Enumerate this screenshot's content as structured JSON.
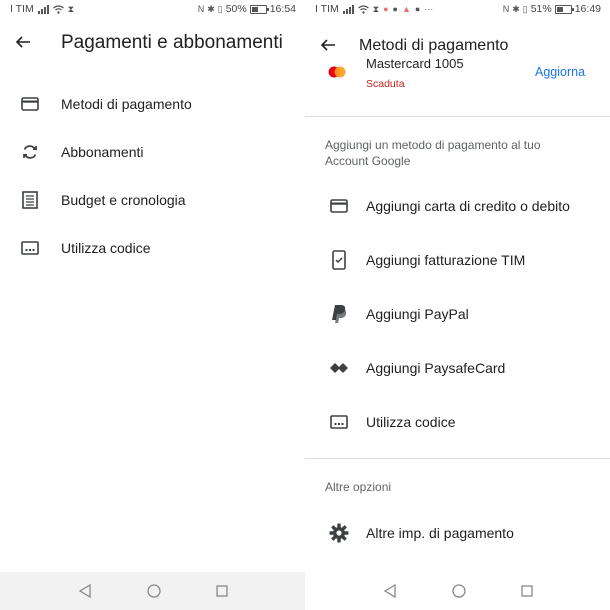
{
  "left": {
    "status": {
      "carrier": "I TIM",
      "battery": "50%",
      "time": "16:54"
    },
    "header": {
      "title": "Pagamenti e abbonamenti"
    },
    "menu": [
      {
        "label": "Metodi di pagamento",
        "icon": "credit-card-icon"
      },
      {
        "label": "Abbonamenti",
        "icon": "sync-icon"
      },
      {
        "label": "Budget e cronologia",
        "icon": "list-icon"
      },
      {
        "label": "Utilizza codice",
        "icon": "redeem-code-icon"
      }
    ]
  },
  "right": {
    "status": {
      "carrier": "I TIM",
      "battery": "51%",
      "time": "16:49"
    },
    "header": {
      "title": "Metodi di pagamento"
    },
    "card": {
      "name": "Mastercard 1005",
      "status": "Scaduta",
      "action": "Aggiorna"
    },
    "add_section": "Aggiungi un metodo di pagamento al tuo Account Google",
    "add_items": [
      {
        "label": "Aggiungi carta di credito o debito",
        "icon": "credit-card-icon"
      },
      {
        "label": "Aggiungi fatturazione TIM",
        "icon": "phone-billing-icon"
      },
      {
        "label": "Aggiungi PayPal",
        "icon": "paypal-icon"
      },
      {
        "label": "Aggiungi PaysafeCard",
        "icon": "paysafecard-icon"
      },
      {
        "label": "Utilizza codice",
        "icon": "redeem-code-icon"
      }
    ],
    "other_section": "Altre opzioni",
    "other_items": [
      {
        "label": "Altre imp. di pagamento",
        "icon": "gear-icon"
      }
    ]
  },
  "colors": {
    "accent": "#1a73e8",
    "error": "#c5221f",
    "text": "#202124",
    "secondary": "#5f6368",
    "divider": "#dadce0"
  }
}
